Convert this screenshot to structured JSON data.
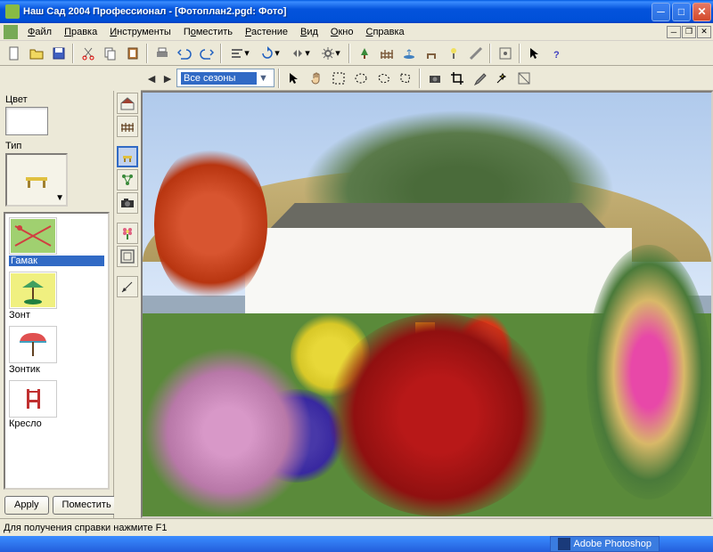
{
  "window": {
    "title": "Наш Сад 2004 Профессионал - [Фотоплан2.pgd: Фото]"
  },
  "menu": {
    "file": "Файл",
    "edit": "Правка",
    "tools": "Инструменты",
    "place": "Поместить",
    "plant": "Растение",
    "view": "Вид",
    "window": "Окно",
    "help": "Справка"
  },
  "toolbar2": {
    "season": "Все сезоны"
  },
  "leftpane": {
    "color_label": "Цвет",
    "type_label": "Тип",
    "items": [
      {
        "label": "Гамак",
        "selected": true
      },
      {
        "label": "Зонт",
        "selected": false
      },
      {
        "label": "Зонтик",
        "selected": false
      },
      {
        "label": "Кресло",
        "selected": false
      }
    ],
    "apply": "Apply",
    "place": "Поместить"
  },
  "status": {
    "help": "Для получения справки нажмите F1"
  },
  "taskbar": {
    "app": "Adobe Photoshop"
  }
}
